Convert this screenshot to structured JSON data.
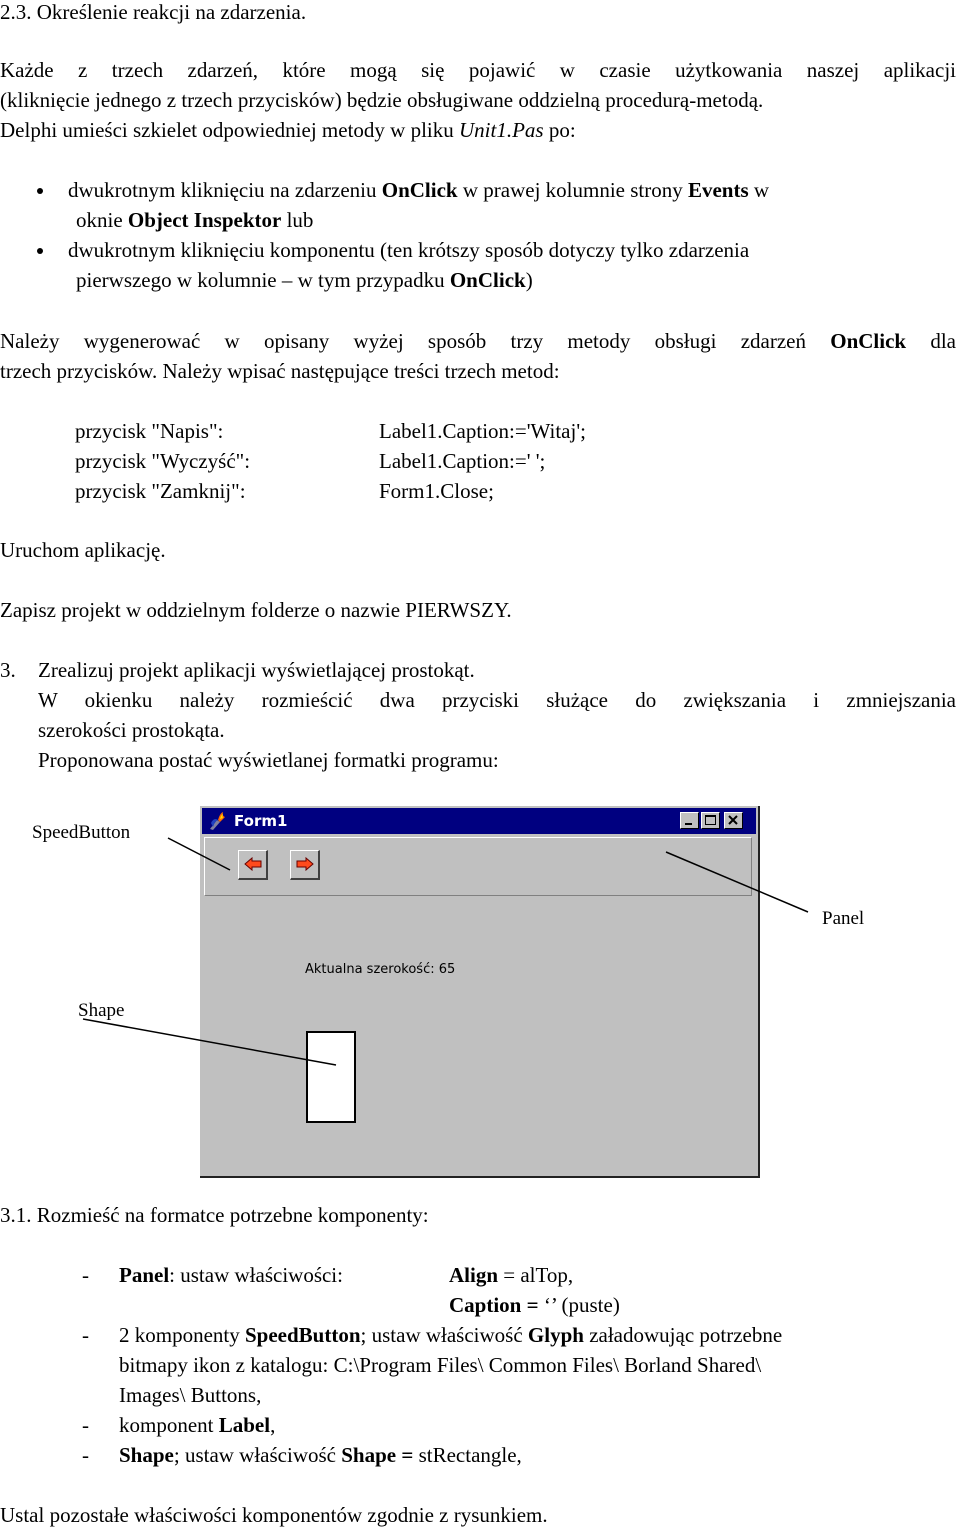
{
  "section_heading": "2.3. Określenie reakcji na zdarzenia.",
  "intro": {
    "line1": "Każde z trzech zdarzeń, które mogą się pojawić w czasie użytkowania naszej aplikacji",
    "line2": "(kliknięcie jednego z trzech przycisków) będzie obsługiwane oddzielną procedurą-metodą.",
    "line3_pre": "Delphi umieści szkielet odpowiedniej metody w pliku ",
    "line3_file": "Unit1.Pas",
    "line3_post": " po:"
  },
  "bullets": [
    {
      "l1_a": "dwukrotnym kliknięciu na zdarzeniu ",
      "l1_b": "OnClick",
      "l1_c": " w prawej kolumnie strony ",
      "l1_d": "Events",
      "l1_e": " w",
      "l2_a": "oknie ",
      "l2_b": "Object Inspektor",
      "l2_c": " lub"
    },
    {
      "l1_a": "dwukrotnym kliknięciu komponentu (ten krótszy sposób dotyczy tylko zdarzenia",
      "l2_a": "pierwszego w kolumnie – w tym przypadku ",
      "l2_b": "OnClick",
      "l2_c": ")"
    }
  ],
  "generate": {
    "line1_a": "Należy wygenerować w opisany wyżej sposób trzy metody obsługi zdarzeń ",
    "line1_b": "OnClick",
    "line1_c": " dla",
    "line2": "trzech przycisków. Należy wpisać następujące treści trzech metod:"
  },
  "methods": [
    {
      "button": "przycisk \"Napis\":",
      "code": "Label1.Caption:='Witaj';"
    },
    {
      "button": "przycisk \"Wyczyść\":",
      "code": "Label1.Caption:=' ';"
    },
    {
      "button": "przycisk \"Zamknij\":",
      "code": "Form1.Close;"
    }
  ],
  "run_app": "Uruchom aplikację.",
  "save_project": "Zapisz projekt w oddzielnym folderze o nazwie PIERWSZY.",
  "task3": {
    "number": "3.",
    "line1": "Zrealizuj projekt aplikacji wyświetlającej prostokąt.",
    "line2": "W okienku należy rozmieścić dwa przyciski służące do zwiększania i zmniejszania",
    "line3": "szerokości prostokąta.",
    "line4": "Proponowana postać wyświetlanej formatki programu:"
  },
  "figure": {
    "window_title": "Form1",
    "label_text": "Aktualna szerokość:  65",
    "callouts": {
      "speedbutton": "SpeedButton",
      "panel": "Panel",
      "shape": "Shape"
    },
    "colors": {
      "titlebar": "#000080",
      "face": "#c0c0c0",
      "arrow": "#ff4a1c"
    }
  },
  "sub31": {
    "heading": "3.1. Rozmieść na formatce potrzebne komponenty:",
    "items": [
      {
        "dash": "-",
        "a_bold": "Panel",
        "a": ": ustaw właściwości:",
        "b_bold": "Align",
        "b": " = alTop,",
        "c_bold": "Caption =",
        "c": " ‘’ (puste)"
      },
      {
        "dash": "-",
        "l1_a": "2 komponenty ",
        "l1_b": "SpeedButton",
        "l1_c": "; ustaw właściwość ",
        "l1_d": "Glyph",
        "l1_e": " załadowując potrzebne",
        "l2": "bitmapy ikon z katalogu: C:\\Program Files\\ Common Files\\ Borland Shared\\",
        "l3": "Images\\ Buttons,"
      },
      {
        "dash": "-",
        "a": "komponent ",
        "b_bold": "Label",
        "c": ","
      },
      {
        "dash": "-",
        "a_bold": "Shape",
        "b": "; ustaw właściwość ",
        "c_bold": "Shape =",
        "d": " stRectangle,"
      }
    ]
  },
  "closing": "Ustal pozostałe właściwości komponentów zgodnie z rysunkiem."
}
